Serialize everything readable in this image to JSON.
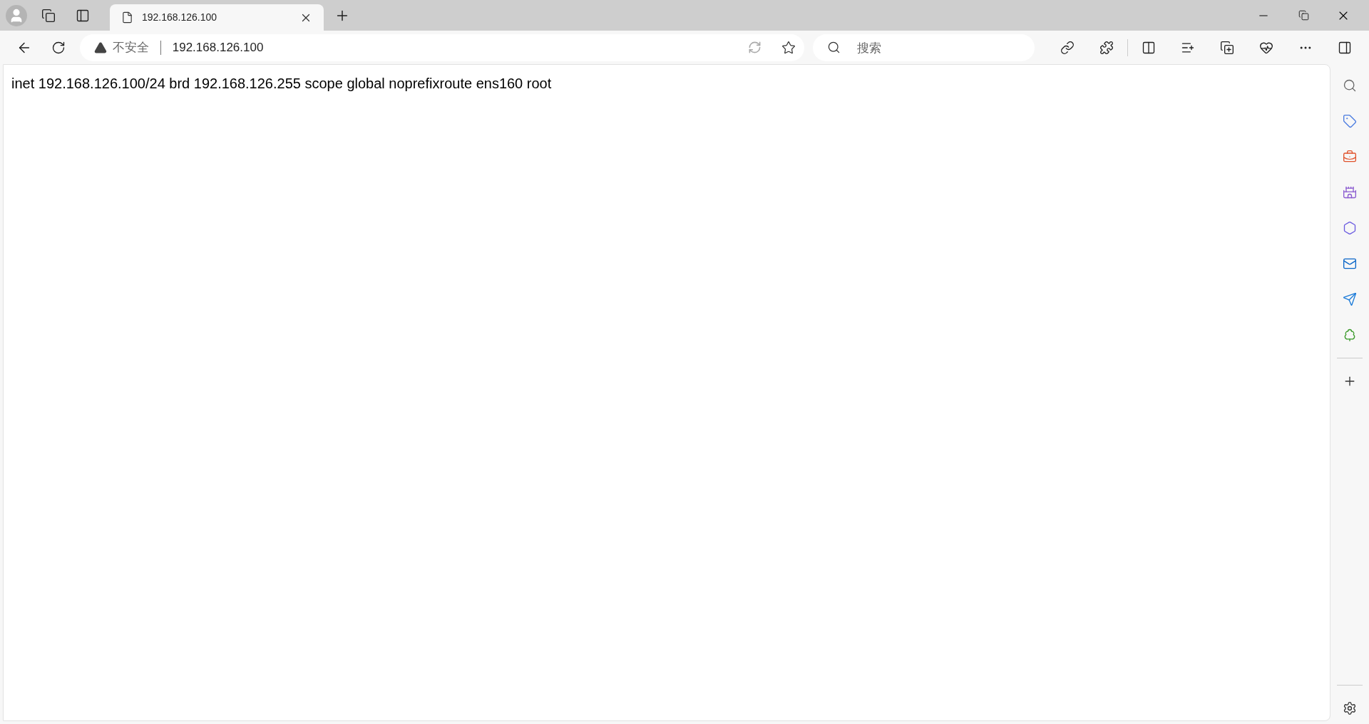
{
  "tab": {
    "title": "192.168.126.100"
  },
  "address_bar": {
    "security": "不安全",
    "url": "192.168.126.100"
  },
  "search": {
    "placeholder": "搜索"
  },
  "page": {
    "text": "inet 192.168.126.100/24 brd 192.168.126.255 scope global noprefixroute ens160 root"
  }
}
